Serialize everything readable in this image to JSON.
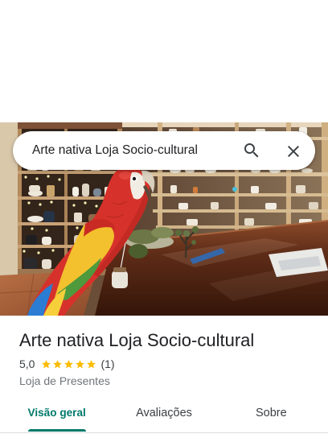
{
  "search": {
    "query": "Arte nativa Loja Socio-cultural",
    "search_icon": "search-icon",
    "close_icon": "close-icon"
  },
  "place": {
    "name": "Arte nativa Loja Socio-cultural",
    "rating": "5,0",
    "stars": 5,
    "review_count": "(1)",
    "category": "Loja de Presentes"
  },
  "tabs": [
    {
      "label": "Visão geral",
      "active": true
    },
    {
      "label": "Avaliações",
      "active": false
    },
    {
      "label": "Sobre",
      "active": false
    }
  ],
  "colors": {
    "accent": "#00796b",
    "star": "#fbbc04",
    "title": "#202124",
    "text": "#3c4043",
    "secondary": "#70757a"
  }
}
